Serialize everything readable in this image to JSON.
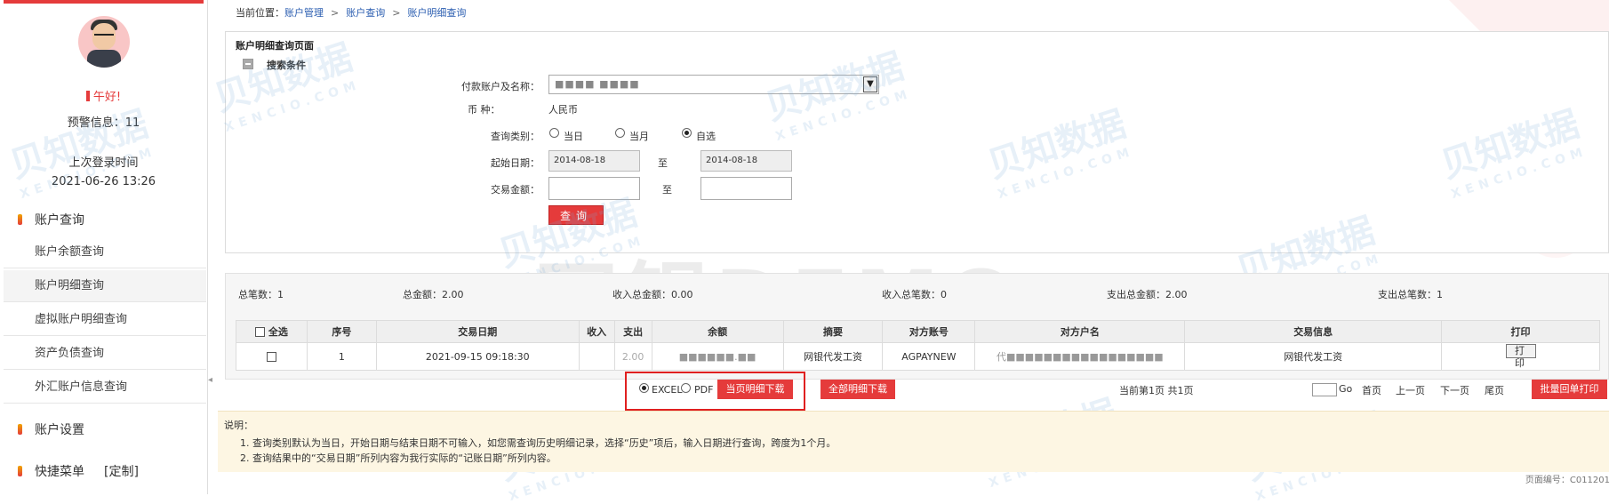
{
  "sidebar": {
    "greeting": "午好!",
    "message": "预警信息：11",
    "last_login_label": "上次登录时间",
    "last_login_time": "2021-06-26 13:26",
    "section_account_query": "账户查询",
    "items": [
      {
        "label": "账户余额查询"
      },
      {
        "label": "账户明细查询"
      },
      {
        "label": "虚拟账户明细查询"
      },
      {
        "label": "资产负债查询"
      },
      {
        "label": "外汇账户信息查询"
      }
    ],
    "section_account_settings": "账户设置",
    "section_shortcut": "快捷菜单",
    "customize": "[定制]"
  },
  "breadcrumb": {
    "prefix": "当前位置：",
    "items": [
      "账户管理",
      "账户查询",
      "账户明细查询"
    ]
  },
  "panel_title": "账户明细查询页面",
  "search": {
    "title": "搜索条件",
    "account_label": "付款账户及名称：",
    "account_value": "■■■■  ■■■■",
    "currency_label": "币        种：",
    "currency_value": "人民币",
    "query_type_label": "查询类别：",
    "query_types": [
      "当日",
      "当月",
      "自选"
    ],
    "query_type_selected": "自选",
    "start_date_label": "起始日期：",
    "start_date": "2014-08-18",
    "to_label": "至",
    "end_date": "2014-08-18",
    "amount_label": "交易金额：",
    "amount_to_label": "至",
    "query_button": "查询"
  },
  "summary": {
    "total_count": "总笔数：1",
    "total_amount": "总金额：2.00",
    "income_amount": "收入总金额：0.00",
    "income_count": "收入总笔数：0",
    "expense_amount": "支出总金额：2.00",
    "expense_count": "支出总笔数：1"
  },
  "table": {
    "select_all": "全选",
    "headers": [
      "序号",
      "交易日期",
      "收入",
      "支出",
      "余额",
      "摘要",
      "对方账号",
      "对方户名",
      "交易信息",
      "打印"
    ],
    "rows": [
      {
        "seq": "1",
        "date": "2021-09-15 09:18:30",
        "income": "",
        "expense": "2.00",
        "balance": "■■■■■■.■■",
        "summary": "网银代发工资",
        "counter_account": "AGPAYNEW",
        "counter_name": "代■■■■■■■■■■■■■■■■■",
        "trade_info": "网银代发工资",
        "print": "打印"
      }
    ]
  },
  "download": {
    "format_excel": "EXCEL",
    "format_pdf": "PDF",
    "selected": "EXCEL",
    "page_download_button": "当页明细下载",
    "all_download_button": "全部明细下载"
  },
  "pager": {
    "status": "当前第1页 共1页",
    "go": "Go",
    "first": "首页",
    "prev": "上一页",
    "next": "下一页",
    "last": "尾页",
    "batch_print_button": "批量回单打印"
  },
  "notes": {
    "title": "说明：",
    "lines": [
      "1.  查询类别默认为当日，开始日期与结束日期不可输入，如您需查询历史明细记录，选择“历史”项后，输入日期进行查询，跨度为1个月。",
      "2.  查询结果中的“交易日期”所列内容为我行实际的“记账日期”所列内容。"
    ]
  },
  "page_number": "页面编号：C011201",
  "watermark": {
    "text": "贝知数据",
    "sub": "XENCIO.COM",
    "demo": "网银DEMO"
  },
  "colors": {
    "accent": "#e53b3b",
    "link": "#2a5db0",
    "note_bg": "#fdf6e3"
  }
}
